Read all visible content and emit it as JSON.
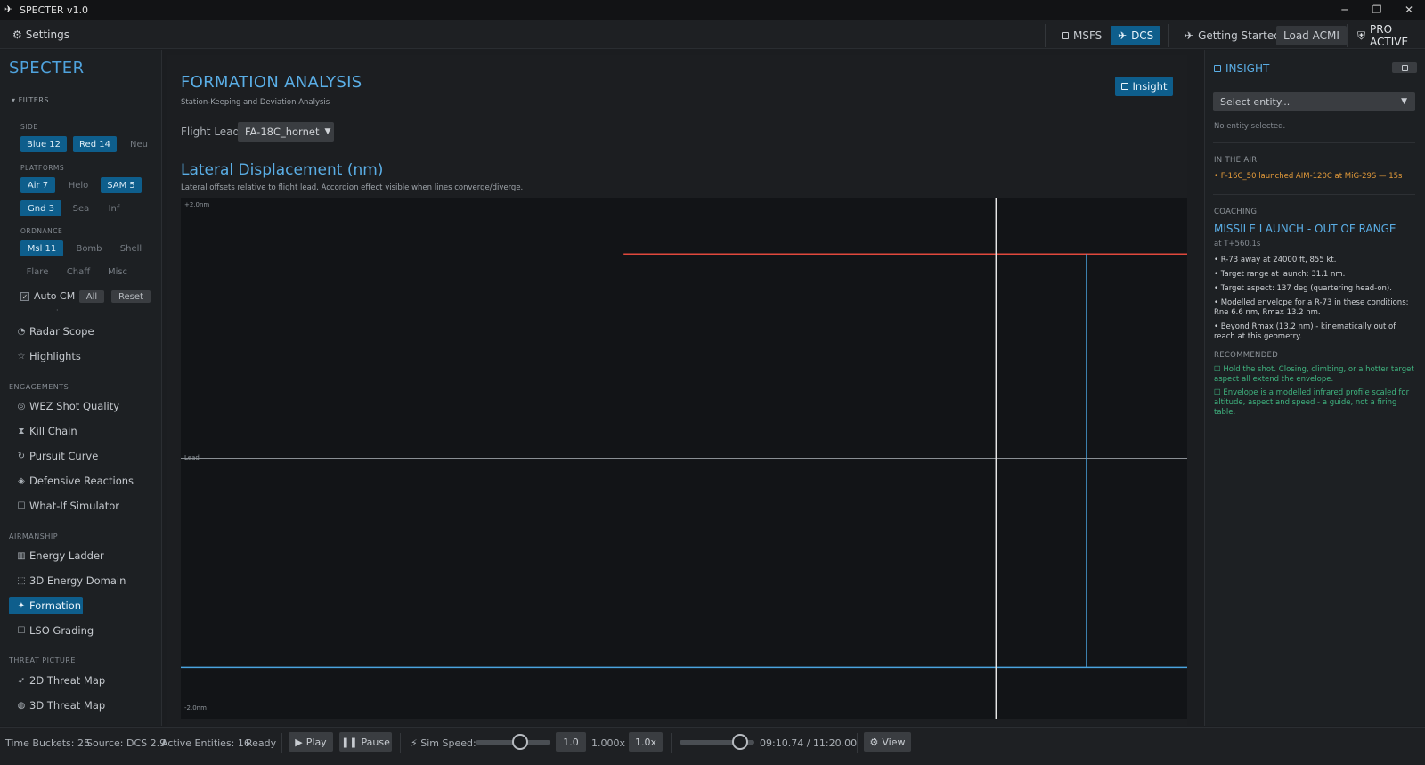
{
  "window": {
    "title": "SPECTER v1.0",
    "minimize": "─",
    "maximize": "❐",
    "close": "✕"
  },
  "topbar": {
    "settings": "Settings",
    "msfs": "MSFS",
    "dcs": "DCS",
    "getting_started": "Getting Started",
    "load_acmi": "Load ACMI",
    "pro": "PRO ACTIVE"
  },
  "sidebar": {
    "brand": "SPECTER",
    "filters": "FILTERS",
    "side_label": "SIDE",
    "side": [
      "Blue 12",
      "Red 14",
      "Neu"
    ],
    "platforms_label": "PLATFORMS",
    "platforms": [
      "Air 7",
      "Helo",
      "SAM 5",
      "Gnd 3",
      "Sea",
      "Inf"
    ],
    "ordnance_label": "ORDNANCE",
    "ordnance": [
      "Msl 11",
      "Bomb",
      "Shell",
      "Flare",
      "Chaff",
      "Misc"
    ],
    "auto_cm": "Auto CM",
    "all": "All",
    "reset": "Reset",
    "dot": "·",
    "items_top": [
      "Radar Scope",
      "Highlights"
    ],
    "engagements_label": "ENGAGEMENTS",
    "engagements": [
      "WEZ Shot Quality",
      "Kill Chain",
      "Pursuit Curve",
      "Defensive Reactions",
      "What-If Simulator"
    ],
    "airmanship_label": "AIRMANSHIP",
    "airmanship": [
      "Energy Ladder",
      "3D Energy Domain",
      "Formation",
      "LSO Grading"
    ],
    "threat_label": "THREAT PICTURE",
    "threat": [
      "2D Threat Map",
      "3D Threat Map"
    ]
  },
  "main": {
    "title": "FORMATION ANALYSIS",
    "subtitle": "Station-Keeping and Deviation Analysis",
    "insight_btn": "Insight",
    "lead_label": "Flight Lead:",
    "lead_value": "FA-18C_hornet",
    "chart_title": "Lateral Displacement (nm)",
    "chart_subtitle": "Lateral offsets relative to flight lead. Accordion effect visible when lines converge/diverge."
  },
  "chart_data": {
    "type": "line",
    "title": "Lateral Displacement (nm)",
    "ylim": [
      -2.0,
      2.0
    ],
    "y_tick_labels": [
      "+2.0nm",
      "Lead",
      "-2.0nm"
    ],
    "lead_y": 0.0,
    "colors": {
      "red": "#e0483c",
      "blue": "#4aa3df",
      "lead": "#8a8f94",
      "cursor": "#e6e6e6"
    },
    "series": [
      {
        "values": [
          [
            0.44,
            1.6
          ],
          [
            1.0,
            1.6
          ]
        ]
      },
      {
        "values": [
          [
            0.0,
            -1.64
          ],
          [
            0.9,
            -1.64
          ],
          [
            0.9,
            1.6
          ],
          [
            0.9,
            -1.64
          ],
          [
            1.0,
            -1.64
          ]
        ]
      }
    ],
    "cursor_x": 0.81
  },
  "insight": {
    "title": "INSIGHT",
    "select_placeholder": "Select entity...",
    "no_entity": "No entity selected.",
    "in_air_label": "IN THE AIR",
    "in_air_event": "• F-16C_50 launched AIM-120C at MiG-29S — 15s",
    "coaching_label": "COACHING",
    "alert": "MISSILE LAUNCH - OUT OF RANGE",
    "alert_time": "at T+560.1s",
    "bullets": [
      "• R-73 away at 24000 ft, 855 kt.",
      "• Target range at launch: 31.1 nm.",
      "• Target aspect: 137 deg (quartering head-on).",
      "• Modelled envelope for a R-73 in these conditions: Rne 6.6 nm, Rmax 13.2 nm.",
      "• Beyond Rmax (13.2 nm) - kinematically out of reach at this geometry."
    ],
    "recommended_label": "RECOMMENDED",
    "recommended": [
      "☐ Hold the shot. Closing, climbing, or a hotter target aspect all extend the envelope.",
      "☐ Envelope is a modelled infrared profile scaled for altitude, aspect and speed - a guide, not a firing table."
    ]
  },
  "status": {
    "buckets": "Time Buckets: 25",
    "source": "Source: DCS 2.9",
    "entities": "Active Entities: 16",
    "ready": "Ready",
    "play": "Play",
    "pause": "Pause",
    "sim_speed": "Sim Speed:",
    "speed_value": "1.0",
    "speed_mult": "1.000x",
    "speed_btn": "1.0x",
    "time": "09:10.74 / 11:20.00",
    "view": "View",
    "sim_speed_fraction": 0.6,
    "timeline_fraction": 0.81
  }
}
